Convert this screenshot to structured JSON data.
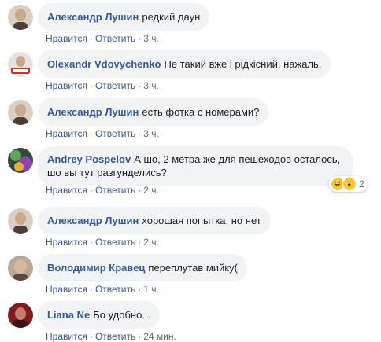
{
  "actions": {
    "like": "Нравится",
    "reply": "Ответить",
    "separator": "·"
  },
  "comments": [
    {
      "author": "Александр Лушин",
      "text": "редкий даун",
      "time": "3 ч.",
      "avatar_color": "#6b5a4a"
    },
    {
      "author": "Olexandr Vdovychenko",
      "text": "Не такий вже і рідкісний, нажаль.",
      "time": "3 ч.",
      "avatar_color": "#c0392b"
    },
    {
      "author": "Александр Лушин",
      "text": "есть фотка с номерами?",
      "time": "3 ч.",
      "avatar_color": "#6b5a4a"
    },
    {
      "author": "Andrey Pospelov",
      "text": "А шо, 2 метра же для пешеходов осталось, шо вы тут разгунделись?",
      "time": "2 ч.",
      "avatar_color": "#3b6b3f",
      "reactions": {
        "icons": [
          "haha-icon",
          "wow-icon"
        ],
        "count": "2"
      }
    },
    {
      "author": "Александр Лушин",
      "text": "хорошая попытка, но нет",
      "time": "2 ч.",
      "avatar_color": "#6b5a4a"
    },
    {
      "author": "Володимир Кравец",
      "text": "переплутав мийку(",
      "time": "1 ч.",
      "avatar_color": "#8a6f5e"
    },
    {
      "author": "Liana Ne",
      "text": "Бо удобно...",
      "time": "24 мин.",
      "avatar_color": "#9b2c2c"
    }
  ]
}
